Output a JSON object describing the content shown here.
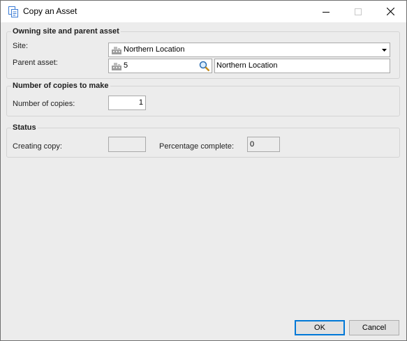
{
  "window": {
    "title": "Copy an Asset"
  },
  "owning_group": {
    "title": "Owning site and parent asset",
    "site_label": "Site:",
    "site_value": "Northern Location",
    "parent_label": "Parent asset:",
    "parent_value": "5",
    "parent_description": "Northern Location"
  },
  "copies_group": {
    "title": "Number of copies to make",
    "copies_label": "Number of copies:",
    "copies_value": "1"
  },
  "status_group": {
    "title": "Status",
    "creating_label": "Creating copy:",
    "creating_value": "",
    "percentage_label": "Percentage complete:",
    "percentage_value": "0"
  },
  "buttons": {
    "ok": "OK",
    "cancel": "Cancel"
  },
  "icons": {
    "app": "copy-documents-icon",
    "site": "building-icon",
    "search": "magnifier-icon"
  },
  "colors": {
    "accent": "#0078d7",
    "dialog_bg": "#ececec"
  }
}
